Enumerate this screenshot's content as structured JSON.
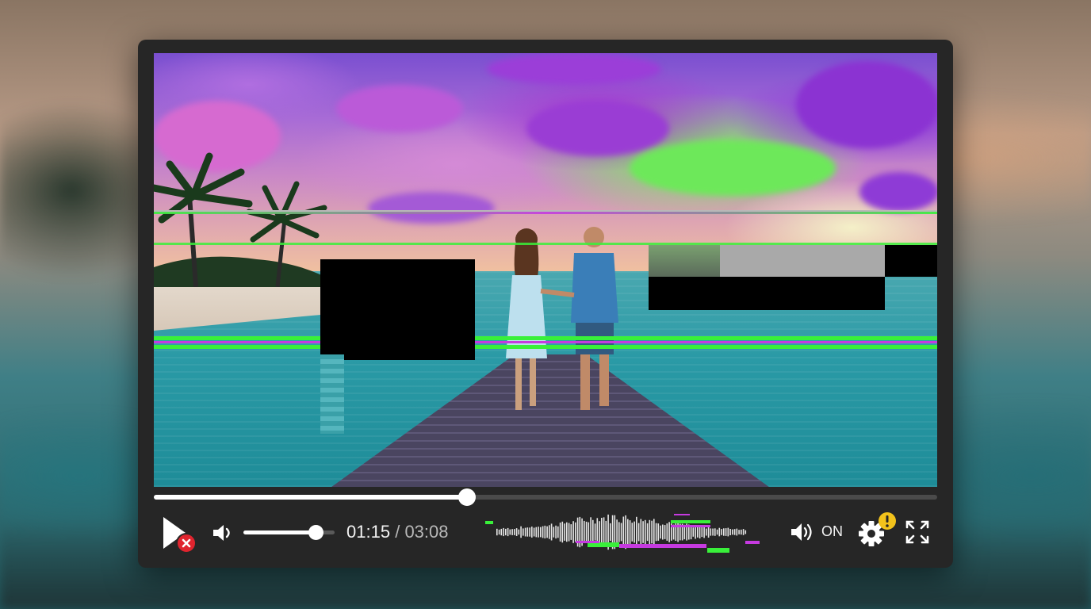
{
  "player": {
    "playback": {
      "current_time": "01:15",
      "separator": "/",
      "duration": "03:08",
      "progress": 0.4
    },
    "volume": {
      "level": 0.79
    },
    "audio_toggle": {
      "label": "ON"
    },
    "icons": {
      "play": "play-icon",
      "error_badge": "error-x-icon",
      "mute": "speaker-low-icon",
      "audio": "speaker-high-icon",
      "settings": "gear-icon",
      "warning": "warning-exclamation-icon",
      "fullscreen": "fullscreen-icon"
    },
    "colors": {
      "error_badge": "#e0242e",
      "warning_badge": "#f2c21b",
      "glitch_green": "#39f03a",
      "glitch_magenta": "#c63ae0"
    }
  }
}
